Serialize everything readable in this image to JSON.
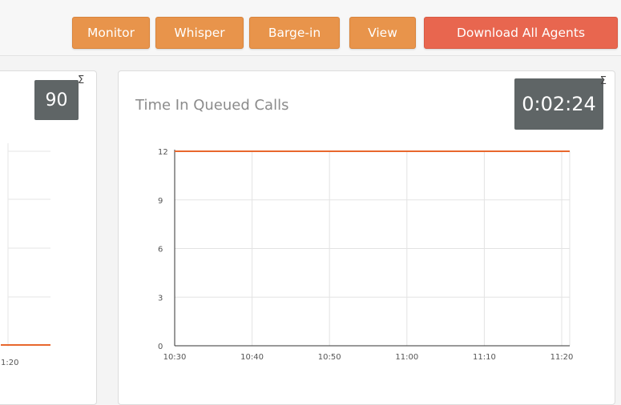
{
  "toolbar": {
    "buttons": [
      {
        "label": "Monitor"
      },
      {
        "label": "Whisper"
      },
      {
        "label": "Barge-in"
      },
      {
        "label": "View"
      },
      {
        "label": "Download All Agents"
      }
    ]
  },
  "left_panel": {
    "counter": "90",
    "sigma": "Σ",
    "partial_tick": "1:20"
  },
  "main_panel": {
    "title": "Time In Queued Calls",
    "counter": "0:02:24",
    "sigma": "Σ"
  },
  "colors": {
    "accent_orange": "#e8944b",
    "accent_red": "#e8664f",
    "counter_bg": "#5f6566",
    "series_line": "#e8672d"
  },
  "chart_data": {
    "type": "line",
    "x": [
      "10:30",
      "10:40",
      "10:50",
      "11:00",
      "11:10",
      "11:20"
    ],
    "y_ticks": [
      0,
      3,
      6,
      9,
      12
    ],
    "ylim": [
      0,
      12
    ],
    "grid": true,
    "series": [
      {
        "values": [
          12,
          12,
          12,
          12,
          12,
          12,
          12
        ]
      }
    ]
  }
}
